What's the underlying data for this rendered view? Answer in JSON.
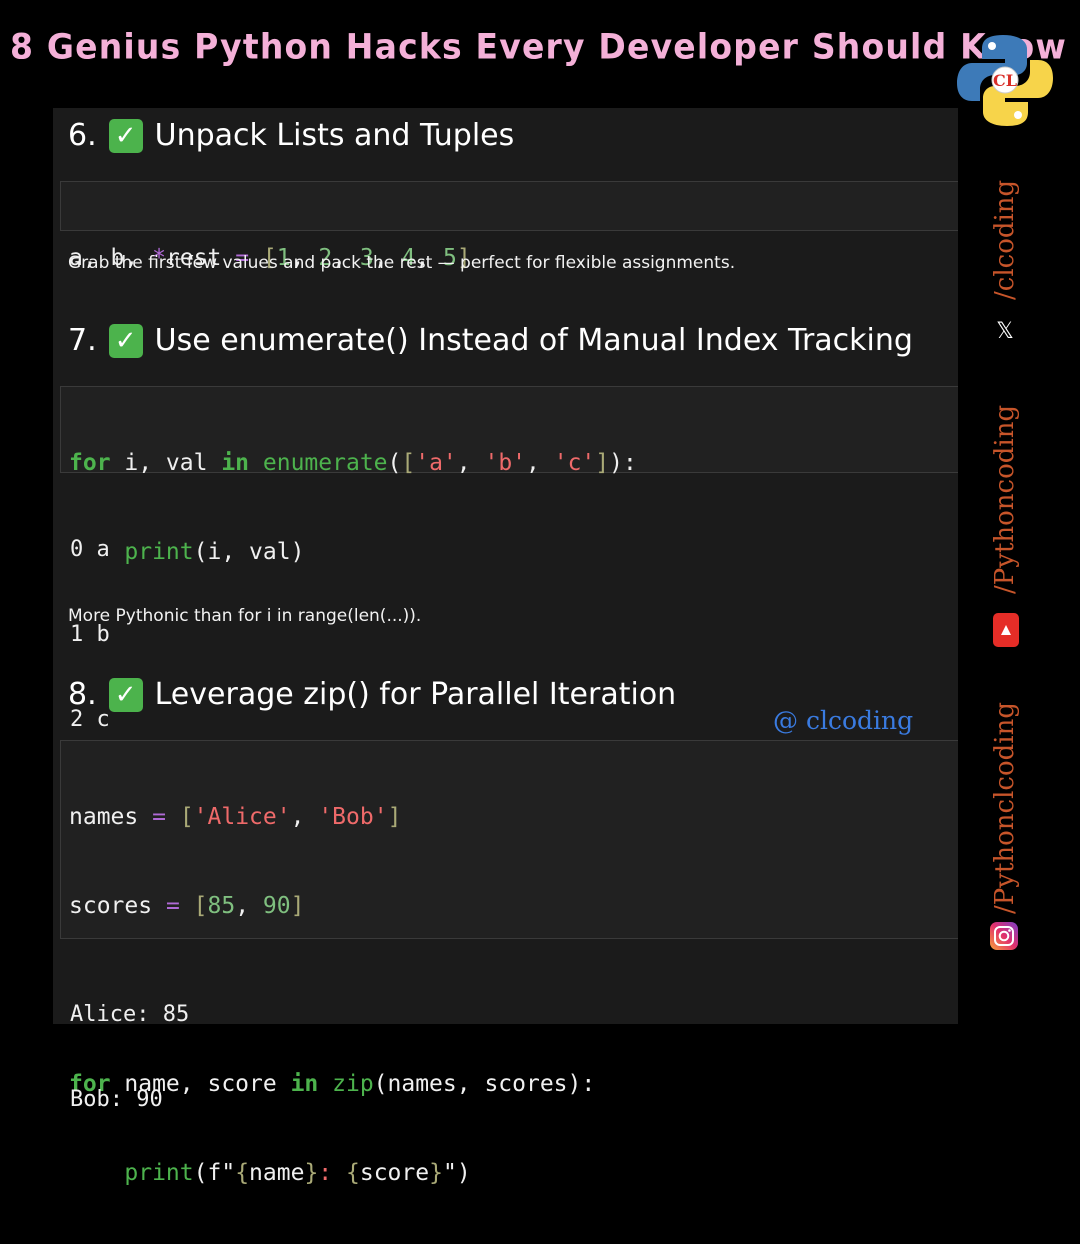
{
  "header": {
    "title": "8 Genius Python Hacks Every Developer Should Know"
  },
  "logo": {
    "icon": "python-logo-icon",
    "badge_text": "CL"
  },
  "colors": {
    "title": "#f4b0d8",
    "keyword": "#4db34d",
    "string": "#ef6a6a",
    "number": "#7fbf7f",
    "operator": "#b06ad6",
    "social_handle": "#c7552a",
    "watermark": "#3a7be0"
  },
  "sections": [
    {
      "number": "6.",
      "heading": "Unpack Lists and Tuples",
      "description": "Grab the first few values and pack the rest — perfect for flexible assignments."
    },
    {
      "number": "7.",
      "heading": "Use enumerate() Instead of Manual Index Tracking",
      "output": [
        "0 a",
        "1 b",
        "2 c"
      ],
      "description": "More Pythonic than for i in range(len(...))."
    },
    {
      "number": "8.",
      "heading": "Leverage zip() for Parallel Iteration",
      "output": [
        "Alice: 85",
        "Bob: 90"
      ]
    }
  ],
  "code": {
    "s6": {
      "a": "a, b, ",
      "star": "*",
      "rest": "rest ",
      "eq": "=",
      "sp": " ",
      "ob": "[",
      "n1": "1",
      "c1": ", ",
      "n2": "2",
      "c2": ", ",
      "n3": "3",
      "c3": ", ",
      "n4": "4",
      "c4": ", ",
      "n5": "5",
      "cb": "]"
    },
    "s7": {
      "for": "for",
      "vars": " i, val ",
      "in": "in",
      "sp": " ",
      "fn": "enumerate",
      "p1": "(",
      "ob": "[",
      "sa": "'a'",
      "c1": ", ",
      "sb": "'b'",
      "c2": ", ",
      "sc": "'c'",
      "cb": "]",
      "p2": "):",
      "indent": "    ",
      "print": "print",
      "args": "(i, val)"
    },
    "s8": {
      "names": "names ",
      "eq1": "=",
      "sp1": " ",
      "ob1": "[",
      "alice": "'Alice'",
      "c1": ", ",
      "bob": "'Bob'",
      "cb1": "]",
      "scores": "scores ",
      "eq2": "=",
      "sp2": " ",
      "ob2": "[",
      "n85": "85",
      "c2": ", ",
      "n90": "90",
      "cb2": "]",
      "for": "for",
      "vars": " name, score ",
      "in": "in",
      "sp3": " ",
      "zip": "zip",
      "zargs": "(names, scores):",
      "indent": "    ",
      "print": "print",
      "fo": "(f\"",
      "lb1": "{",
      "name": "name",
      "rb1": "}",
      "colon": ": ",
      "lb2": "{",
      "score": "score",
      "rb2": "}",
      "fc": "\")"
    }
  },
  "watermark": "@ clcoding",
  "social": [
    {
      "handle": "/clcoding",
      "icon": "x-twitter-icon"
    },
    {
      "handle": "/Pythoncoding",
      "icon": "youtube-icon"
    },
    {
      "handle": "/Pythonclcoding",
      "icon": "instagram-icon"
    }
  ]
}
